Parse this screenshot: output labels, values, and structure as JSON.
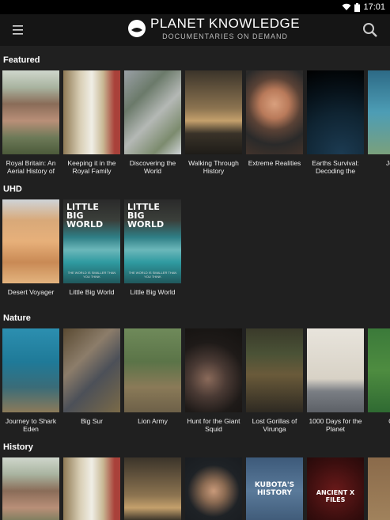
{
  "status": {
    "time": "17:01"
  },
  "header": {
    "title": "PLANET KNOWLEDGE",
    "subtitle": "DOCUMENTARIES ON DEMAND"
  },
  "sections": [
    {
      "title": "Featured",
      "items": [
        {
          "title": "Royal Britain: An Aerial History of the..."
        },
        {
          "title": "Keeping it in the Royal Family"
        },
        {
          "title": "Discovering the World"
        },
        {
          "title": "Walking Through History"
        },
        {
          "title": "Extreme Realities"
        },
        {
          "title": "Earths Survival: Decoding the Scien..."
        },
        {
          "title": "Journe"
        }
      ]
    },
    {
      "title": "UHD",
      "items": [
        {
          "title": "Desert Voyager"
        },
        {
          "title": "Little Big World",
          "poster_title": "LITTLE BIG WORLD",
          "poster_sub": "THE WORLD IS SMALLER THAN YOU THINK"
        },
        {
          "title": "Little Big World",
          "poster_title": "LITTLE BIG WORLD",
          "poster_sub": "THE WORLD IS SMALLER THAN YOU THINK"
        }
      ]
    },
    {
      "title": "Nature",
      "items": [
        {
          "title": "Journey to Shark Eden"
        },
        {
          "title": "Big Sur"
        },
        {
          "title": "Lion Army"
        },
        {
          "title": "Hunt for the Giant Squid"
        },
        {
          "title": "Lost Gorillas of Virunga"
        },
        {
          "title": "1000 Days for the Planet"
        },
        {
          "title": "Cruci"
        }
      ]
    },
    {
      "title": "History",
      "items": [
        {
          "poster_title": ""
        },
        {
          "poster_title": ""
        },
        {
          "poster_title": ""
        },
        {
          "poster_title": ""
        },
        {
          "poster_title": "KUBOTA'S HISTORY"
        },
        {
          "poster_title": "ANCIENT X FILES"
        },
        {
          "poster_title": ""
        }
      ]
    }
  ],
  "colors": {
    "background": "#202020",
    "appbar": "#151515",
    "statusbar": "#000000"
  }
}
